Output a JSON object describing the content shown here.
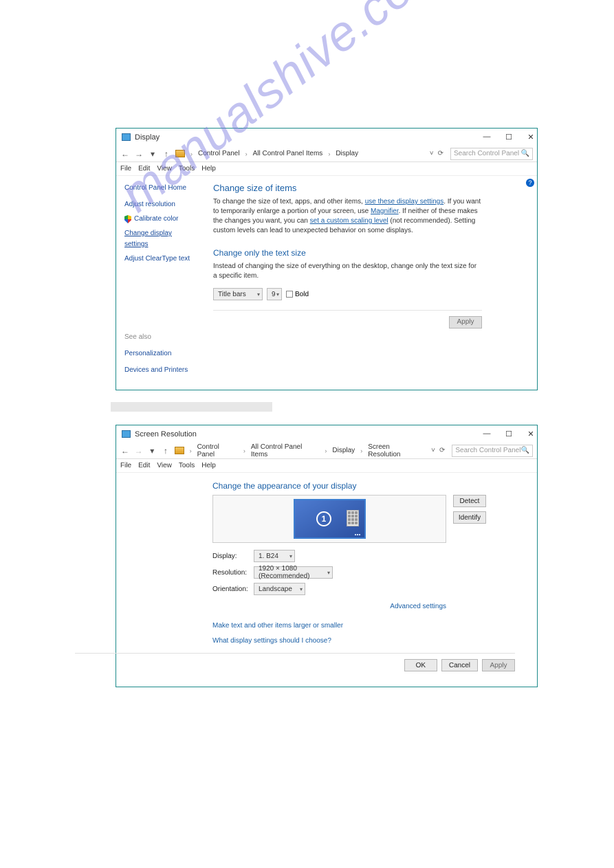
{
  "watermark": "manualshive.com",
  "window1": {
    "title": "Display",
    "breadcrumb": [
      "Control Panel",
      "All Control Panel Items",
      "Display"
    ],
    "search_placeholder": "Search Control Panel",
    "menu": [
      "File",
      "Edit",
      "View",
      "Tools",
      "Help"
    ],
    "sidebar": {
      "home": "Control Panel Home",
      "items": [
        {
          "label": "Adjust resolution"
        },
        {
          "label": "Calibrate color",
          "shield": true
        },
        {
          "label": "Change display settings",
          "selected": true
        },
        {
          "label": "Adjust ClearType text"
        }
      ]
    },
    "see_also": {
      "label": "See also",
      "links": [
        "Personalization",
        "Devices and Printers"
      ]
    },
    "main": {
      "h1": "Change size of items",
      "p1a": "To change the size of text, apps, and other items, ",
      "p1_link1": "use these display settings",
      "p1b": ". If you want to temporarily enlarge a portion of your screen, use ",
      "p1_link2": "Magnifier",
      "p1c": ". If neither of these makes the changes you want, you can ",
      "p1_link3": "set a custom scaling level",
      "p1d": " (not recommended). Setting custom levels can lead to unexpected behavior on some displays.",
      "h2": "Change only the text size",
      "p2": "Instead of changing the size of everything on the desktop, change only the text size for a specific item.",
      "dd_item": "Title bars",
      "dd_size": "9",
      "bold": "Bold",
      "apply": "Apply"
    }
  },
  "window2": {
    "title": "Screen Resolution",
    "breadcrumb": [
      "Control Panel",
      "All Control Panel Items",
      "Display",
      "Screen Resolution"
    ],
    "search_placeholder": "Search Control Panel",
    "menu": [
      "File",
      "Edit",
      "View",
      "Tools",
      "Help"
    ],
    "h1": "Change the appearance of your display",
    "detect": "Detect",
    "identify": "Identify",
    "monitor_num": "1",
    "rows": {
      "display": {
        "label": "Display:",
        "value": "1. B24"
      },
      "resolution": {
        "label": "Resolution:",
        "value": "1920 × 1080 (Recommended)"
      },
      "orientation": {
        "label": "Orientation:",
        "value": "Landscape"
      }
    },
    "adv": "Advanced settings",
    "link1": "Make text and other items larger or smaller",
    "link2": "What display settings should I choose?",
    "ok": "OK",
    "cancel": "Cancel",
    "apply": "Apply"
  }
}
